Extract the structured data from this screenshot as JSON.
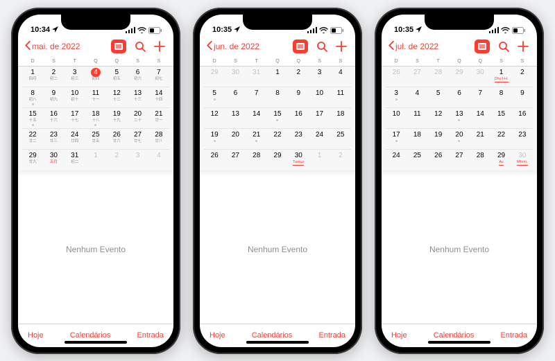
{
  "common": {
    "weekdays": [
      "D",
      "S",
      "T",
      "Q",
      "Q",
      "S",
      "S"
    ],
    "no_events": "Nenhum Evento",
    "toolbar": {
      "today": "Hoje",
      "calendars": "Calendários",
      "inbox": "Entrada"
    }
  },
  "phones": [
    {
      "time": "10:34",
      "month_label": "mai. de 2022",
      "today": 4,
      "weeks": [
        [
          {
            "n": 1,
            "sub": "四月"
          },
          {
            "n": 2,
            "sub": "初二"
          },
          {
            "n": 3,
            "sub": "初三"
          },
          {
            "n": 4,
            "sub": "初四",
            "today": true
          },
          {
            "n": 5,
            "sub": "初五"
          },
          {
            "n": 6,
            "sub": "初六"
          },
          {
            "n": 7,
            "sub": "初七"
          }
        ],
        [
          {
            "n": 8,
            "sub": "初八",
            "dot": true
          },
          {
            "n": 9,
            "sub": "初九"
          },
          {
            "n": 10,
            "sub": "初十"
          },
          {
            "n": 11,
            "sub": "十一"
          },
          {
            "n": 12,
            "sub": "十二"
          },
          {
            "n": 13,
            "sub": "十三"
          },
          {
            "n": 14,
            "sub": "十四"
          }
        ],
        [
          {
            "n": 15,
            "sub": "十五",
            "dot": true
          },
          {
            "n": 16,
            "sub": "十六"
          },
          {
            "n": 17,
            "sub": "十七"
          },
          {
            "n": 18,
            "sub": "十八",
            "dot": true
          },
          {
            "n": 19,
            "sub": "十九"
          },
          {
            "n": 20,
            "sub": "二十"
          },
          {
            "n": 21,
            "sub": "廿一"
          }
        ],
        [
          {
            "n": 22,
            "sub": "廿二"
          },
          {
            "n": 23,
            "sub": "廿三"
          },
          {
            "n": 24,
            "sub": "廿四"
          },
          {
            "n": 25,
            "sub": "廿五"
          },
          {
            "n": 26,
            "sub": "廿六"
          },
          {
            "n": 27,
            "sub": "廿七"
          },
          {
            "n": 28,
            "sub": "廿八"
          }
        ],
        [
          {
            "n": 29,
            "sub": "廿九"
          },
          {
            "n": 30,
            "sub": "五月",
            "subred": true
          },
          {
            "n": 31,
            "sub": "初二"
          },
          {
            "n": 1,
            "out": true
          },
          {
            "n": 2,
            "out": true
          },
          {
            "n": 3,
            "out": true
          },
          {
            "n": 4,
            "out": true
          }
        ]
      ]
    },
    {
      "time": "10:35",
      "month_label": "jun. de 2022",
      "weeks": [
        [
          {
            "n": 29,
            "out": true
          },
          {
            "n": 30,
            "out": true
          },
          {
            "n": 31,
            "out": true
          },
          {
            "n": 1
          },
          {
            "n": 2
          },
          {
            "n": 3
          },
          {
            "n": 4
          }
        ],
        [
          {
            "n": 5,
            "dot": true
          },
          {
            "n": 6
          },
          {
            "n": 7
          },
          {
            "n": 8
          },
          {
            "n": 9
          },
          {
            "n": 10
          },
          {
            "n": 11
          }
        ],
        [
          {
            "n": 12
          },
          {
            "n": 13
          },
          {
            "n": 14
          },
          {
            "n": 15,
            "dot": true
          },
          {
            "n": 16
          },
          {
            "n": 17
          },
          {
            "n": 18
          }
        ],
        [
          {
            "n": 19,
            "dot": true
          },
          {
            "n": 20
          },
          {
            "n": 21,
            "dot": true
          },
          {
            "n": 22
          },
          {
            "n": 23
          },
          {
            "n": 24
          },
          {
            "n": 25
          }
        ],
        [
          {
            "n": 26
          },
          {
            "n": 27
          },
          {
            "n": 28
          },
          {
            "n": 29
          },
          {
            "n": 30,
            "sub": "Tamuz",
            "subredline": true
          },
          {
            "n": 1,
            "out": true
          },
          {
            "n": 2,
            "out": true
          }
        ]
      ]
    },
    {
      "time": "10:35",
      "month_label": "jul. de 2022",
      "weeks": [
        [
          {
            "n": 26,
            "out": true
          },
          {
            "n": 27,
            "out": true
          },
          {
            "n": 28,
            "out": true
          },
          {
            "n": 29,
            "out": true
          },
          {
            "n": 30,
            "out": true
          },
          {
            "n": 1,
            "sub": "Dhuʻl-H.",
            "subredline": true
          },
          {
            "n": 2
          }
        ],
        [
          {
            "n": 3,
            "dot": true
          },
          {
            "n": 4
          },
          {
            "n": 5
          },
          {
            "n": 6
          },
          {
            "n": 7
          },
          {
            "n": 8
          },
          {
            "n": 9
          }
        ],
        [
          {
            "n": 10
          },
          {
            "n": 11
          },
          {
            "n": 12
          },
          {
            "n": 13,
            "dot": true
          },
          {
            "n": 14
          },
          {
            "n": 15
          },
          {
            "n": 16
          }
        ],
        [
          {
            "n": 17,
            "dot": true
          },
          {
            "n": 18
          },
          {
            "n": 19
          },
          {
            "n": 20,
            "dot": true
          },
          {
            "n": 21
          },
          {
            "n": 22
          },
          {
            "n": 23
          }
        ],
        [
          {
            "n": 24
          },
          {
            "n": 25
          },
          {
            "n": 26
          },
          {
            "n": 27
          },
          {
            "n": 28
          },
          {
            "n": 29,
            "sub": "Av",
            "subredline": true
          },
          {
            "n": 30,
            "out": true,
            "sub": "Mhrm.",
            "subredline": true
          }
        ]
      ]
    }
  ]
}
